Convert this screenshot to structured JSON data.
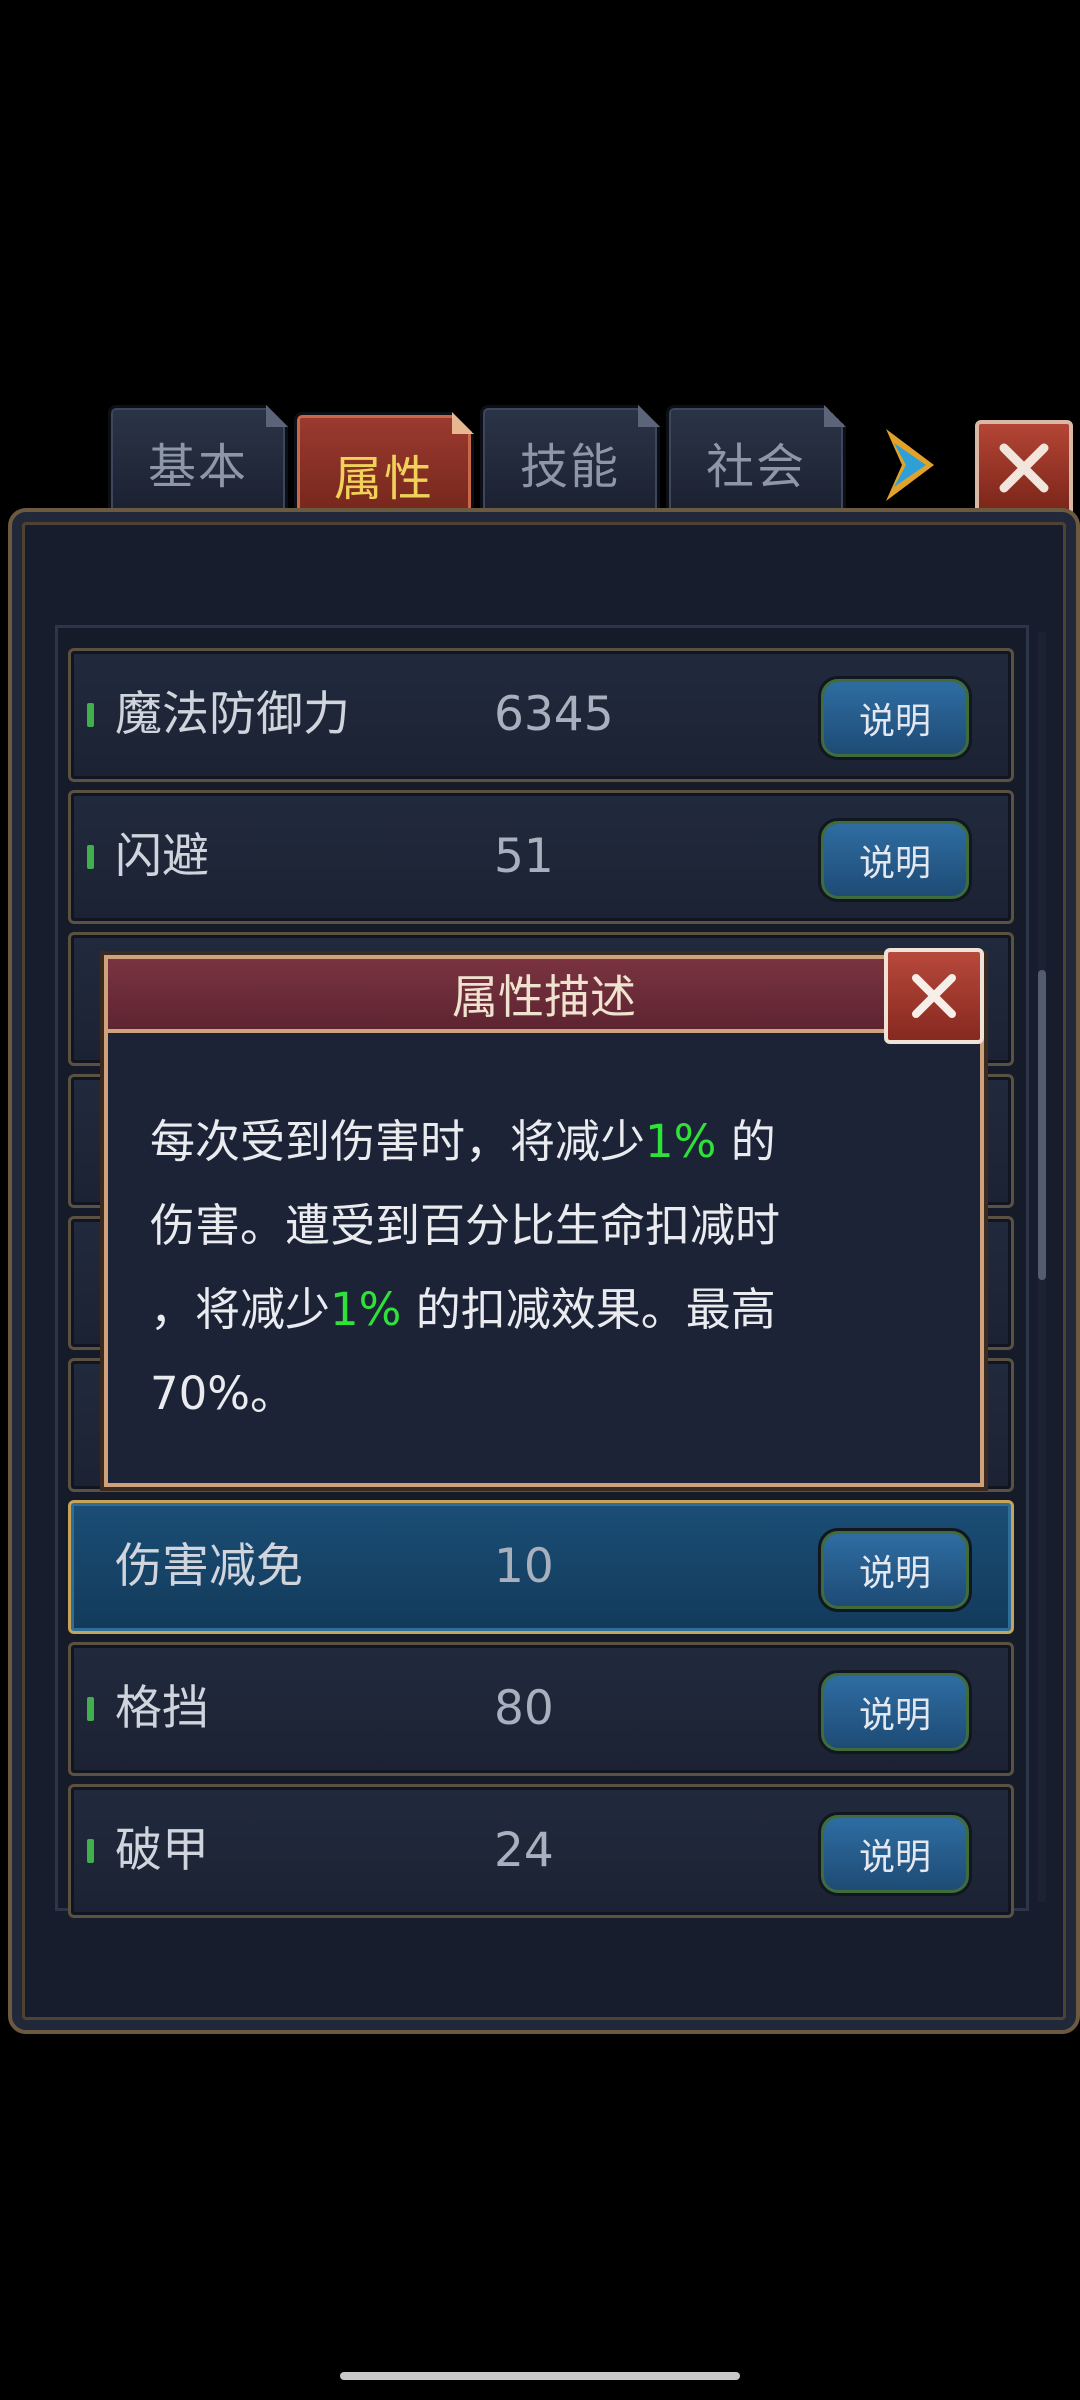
{
  "tabs": [
    {
      "label": "基本",
      "active": false
    },
    {
      "label": "属性",
      "active": true
    },
    {
      "label": "技能",
      "active": false
    },
    {
      "label": "社会",
      "active": false
    }
  ],
  "rows": [
    {
      "name": "魔法防御力",
      "value": "6345",
      "button": "说明"
    },
    {
      "name": "闪避",
      "value": "51",
      "button": "说明"
    },
    {
      "name": "伤害减免",
      "value": "10",
      "button": "说明",
      "selected": true
    },
    {
      "name": "格挡",
      "value": "80",
      "button": "说明"
    },
    {
      "name": "破甲",
      "value": "24",
      "button": "说明"
    }
  ],
  "popup": {
    "title": "属性描述",
    "line1_pre": "每次受到伤害时，将减少",
    "line1_hl": "1%",
    "line1_post": " 的",
    "line2": "伤害。遭受到百分比生命扣减时",
    "line3_pre": "，将减少",
    "line3_hl": "1%",
    "line3_post": " 的扣减效果。最高",
    "line4": "70%。"
  },
  "colors": {
    "highlight": "#2ee23a",
    "active_tab": "#f0d25a",
    "accent_border": "#cfa27e"
  }
}
